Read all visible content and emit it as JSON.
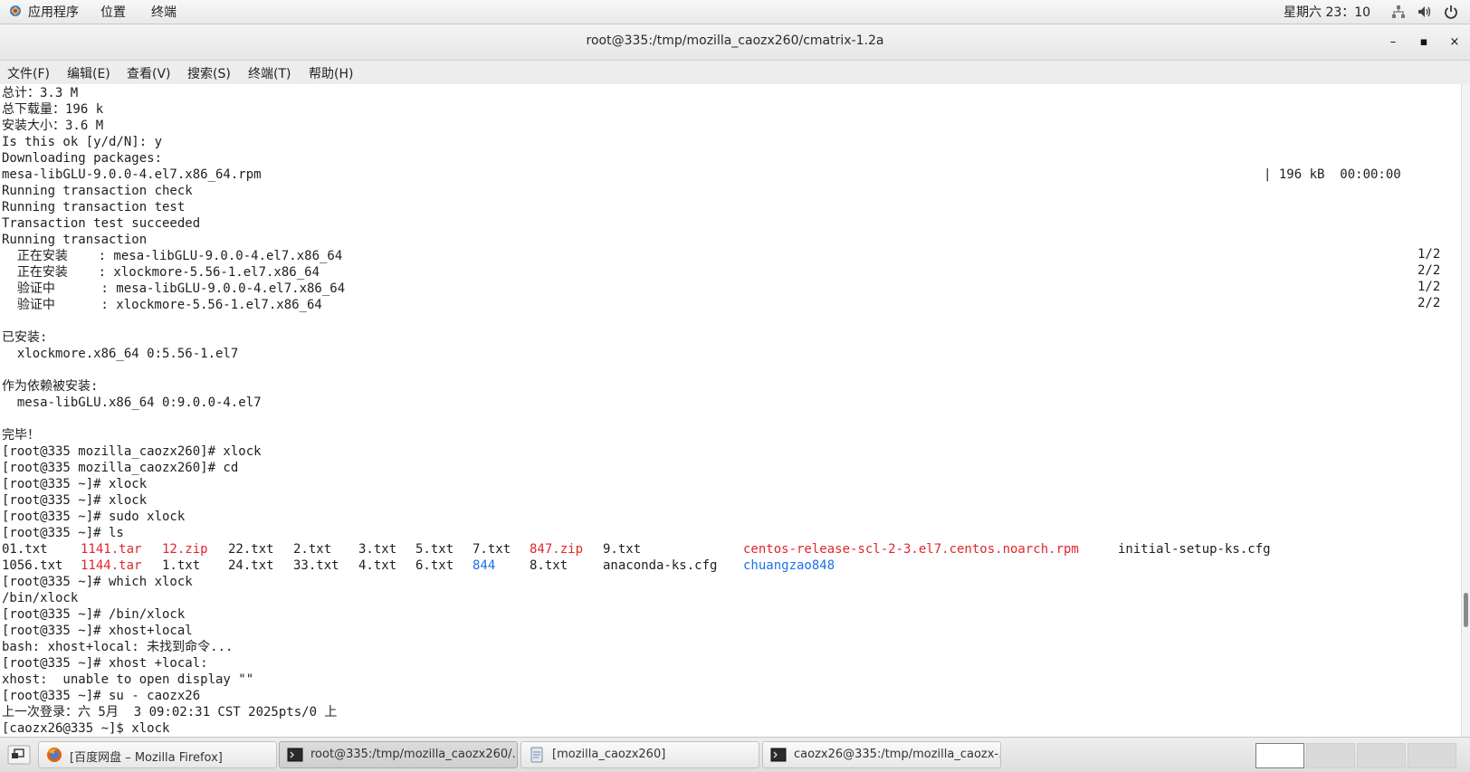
{
  "topbar": {
    "menus": [
      "应用程序",
      "位置",
      "终端"
    ],
    "clock": "星期六 23：10"
  },
  "window": {
    "title": "root@335:/tmp/mozilla_caozx260/cmatrix-1.2a",
    "buttons": [
      "–",
      "▪",
      "×"
    ]
  },
  "menubar": [
    "文件(F)",
    "编辑(E)",
    "查看(V)",
    "搜索(S)",
    "终端(T)",
    "帮助(H)"
  ],
  "terminal": {
    "lines": [
      "总计：3.3 M",
      "总下载量：196 k",
      "安装大小：3.6 M",
      "Is this ok [y/d/N]: y",
      "Downloading packages:",
      "mesa-libGLU-9.0.0-4.el7.x86_64.rpm",
      "Running transaction check",
      "Running transaction test",
      "Transaction test succeeded",
      "Running transaction",
      "  正在安装    : mesa-libGLU-9.0.0-4.el7.x86_64",
      "  正在安装    : xlockmore-5.56-1.el7.x86_64",
      "  验证中      : mesa-libGLU-9.0.0-4.el7.x86_64",
      "  验证中      : xlockmore-5.56-1.el7.x86_64",
      "",
      "已安装:",
      "  xlockmore.x86_64 0:5.56-1.el7",
      "",
      "作为依赖被安装:",
      "  mesa-libGLU.x86_64 0:9.0.0-4.el7",
      "",
      "完毕！",
      "[root@335 mozilla_caozx260]# xlock",
      "[root@335 mozilla_caozx260]# cd",
      "[root@335 ~]# xlock",
      "[root@335 ~]# xlock",
      "[root@335 ~]# sudo xlock",
      "[root@335 ~]# ls",
      "",
      "",
      "[root@335 ~]# which xlock",
      "/bin/xlock",
      "[root@335 ~]# /bin/xlock",
      "[root@335 ~]# xhost+local",
      "bash: xhost+local: 未找到命令...",
      "[root@335 ~]# xhost +local:",
      "xhost:  unable to open display \"\"",
      "[root@335 ~]# su - caozx26",
      "上一次登录：六 5月  3 09:02:31 CST 2025pts/0 上",
      "[caozx26@335 ~]$ xlock"
    ],
    "download_progress": "| 196 kB  00:00:00",
    "tx_counts": [
      "1/2",
      "2/2",
      "1/2",
      "2/2"
    ],
    "ls_row1": [
      {
        "t": "01.txt",
        "c": ""
      },
      {
        "t": "1141.tar",
        "c": "red"
      },
      {
        "t": "12.zip",
        "c": "red"
      },
      {
        "t": "22.txt",
        "c": ""
      },
      {
        "t": "2.txt",
        "c": ""
      },
      {
        "t": "3.txt",
        "c": ""
      },
      {
        "t": "5.txt",
        "c": ""
      },
      {
        "t": "7.txt",
        "c": ""
      },
      {
        "t": "847.zip",
        "c": "red"
      },
      {
        "t": "9.txt",
        "c": ""
      },
      {
        "t": "centos-release-scl-2-3.el7.centos.noarch.rpm",
        "c": "red"
      },
      {
        "t": "initial-setup-ks.cfg",
        "c": ""
      }
    ],
    "ls_row2": [
      {
        "t": "1056.txt",
        "c": ""
      },
      {
        "t": "1144.tar",
        "c": "red"
      },
      {
        "t": "1.txt",
        "c": ""
      },
      {
        "t": "24.txt",
        "c": ""
      },
      {
        "t": "33.txt",
        "c": ""
      },
      {
        "t": "4.txt",
        "c": ""
      },
      {
        "t": "6.txt",
        "c": ""
      },
      {
        "t": "844",
        "c": "blue"
      },
      {
        "t": "8.txt",
        "c": ""
      },
      {
        "t": "anaconda-ks.cfg",
        "c": ""
      },
      {
        "t": "chuangzao848",
        "c": "blue"
      }
    ]
  },
  "taskbar": {
    "tasks": [
      "[百度网盘 – Mozilla Firefox]",
      "root@335:/tmp/mozilla_caozx260/…",
      "[mozilla_caozx260]",
      "caozx26@335:/tmp/mozilla_caozx-…"
    ]
  },
  "colors": {
    "ls_archive": "#e0262c",
    "ls_directory": "#1f6fe6"
  }
}
